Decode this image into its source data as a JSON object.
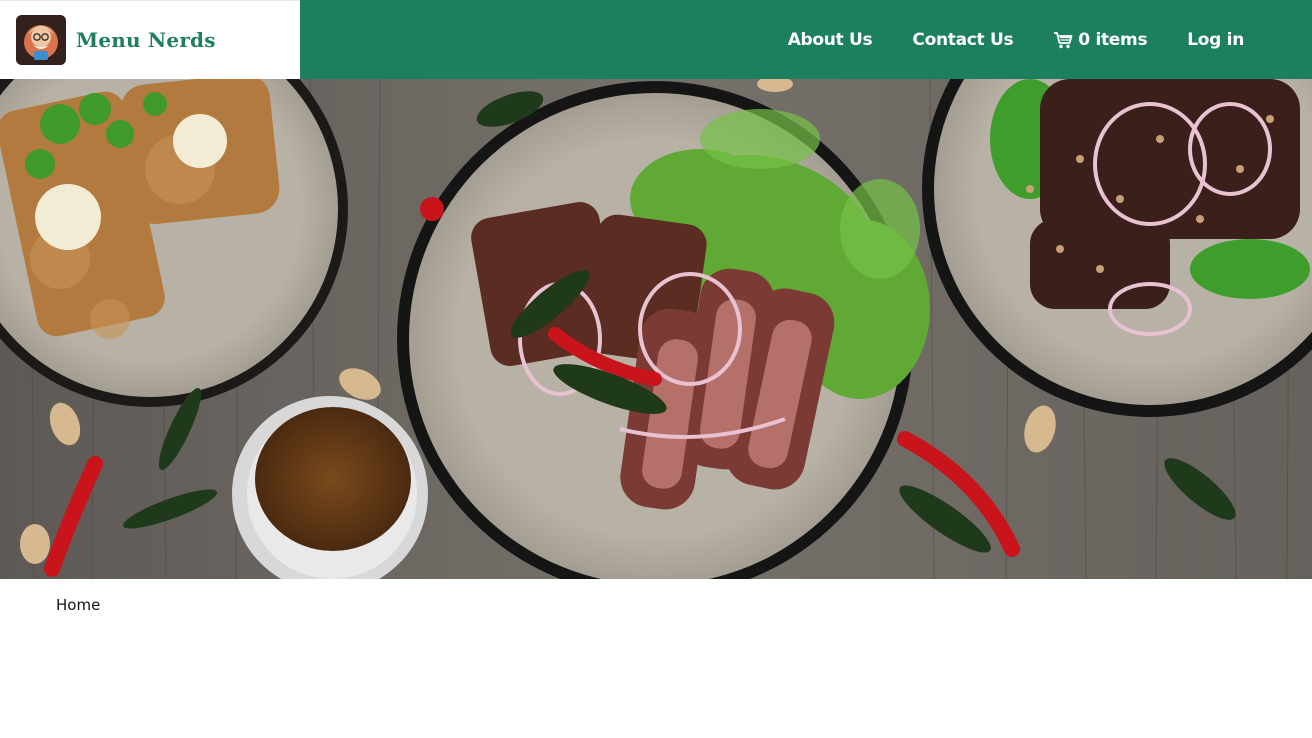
{
  "brand": {
    "name": "Menu Nerds"
  },
  "nav": {
    "about": "About Us",
    "contact": "Contact Us",
    "cart": "0 items",
    "login": "Log in"
  },
  "breadcrumb": {
    "home": "Home"
  },
  "colors": {
    "nav_bg": "#1c7f5d",
    "brand_text": "#1e7f5c"
  }
}
